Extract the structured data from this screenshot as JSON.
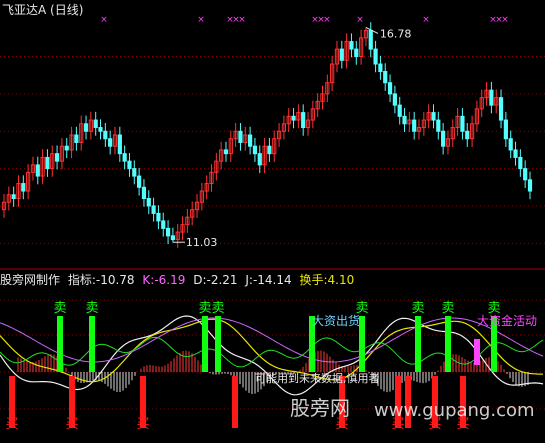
{
  "title": {
    "stock": "飞亚达A",
    "period": "(日线)"
  },
  "indicator": {
    "source": "股旁网制作",
    "zhibiao": "指标:-10.78",
    "k": "K:-6.19",
    "d": "D:-2.21",
    "j": "J:-14.14",
    "turnover": "换手:4.10"
  },
  "annotations": {
    "high_price": "16.78",
    "low_price": "11.03",
    "big_money_out": "大资出货",
    "big_money_active": "大资金活动",
    "future_warning": "可能用到未来数据,慎用者",
    "watermark_cn": "股旁网",
    "watermark_url": "www.gupang.com"
  },
  "signals": {
    "sell": "卖",
    "buy": "买",
    "mark": "×"
  },
  "colors": {
    "up": "#ff3232",
    "down": "#54ffff",
    "grid": "#8b0000",
    "sell_bar": "#11ff11",
    "buy_bar": "#ff1a1a",
    "magenta": "#ff44ff",
    "white_line": "#f0f0f0",
    "yellow_line": "#e6e600",
    "purple_line": "#cc66ff",
    "green_line": "#22dd22"
  },
  "chart_data": {
    "type": "candlestick",
    "price_range": [
      10.5,
      17.3
    ],
    "close_series": [
      12.1,
      12.3,
      12.2,
      12.6,
      12.4,
      12.9,
      13.1,
      12.8,
      13.3,
      13.0,
      13.4,
      13.2,
      13.6,
      13.5,
      13.9,
      13.7,
      14.2,
      14.0,
      14.3,
      14.1,
      14.0,
      13.8,
      13.6,
      13.9,
      13.4,
      13.2,
      13.0,
      12.8,
      12.5,
      12.2,
      12.0,
      11.8,
      11.6,
      11.4,
      11.2,
      11.1,
      11.3,
      11.5,
      11.7,
      11.9,
      12.1,
      12.4,
      12.6,
      12.9,
      13.2,
      13.5,
      13.4,
      13.8,
      14.0,
      13.7,
      13.9,
      13.6,
      13.4,
      13.1,
      13.6,
      13.4,
      13.8,
      14.0,
      14.2,
      14.4,
      14.3,
      14.5,
      14.1,
      14.3,
      14.6,
      14.8,
      15.0,
      15.3,
      15.8,
      16.2,
      15.9,
      16.4,
      16.2,
      16.0,
      16.5,
      16.7,
      16.2,
      15.8,
      15.6,
      15.3,
      15.0,
      14.7,
      14.4,
      14.2,
      14.3,
      14.0,
      14.1,
      14.3,
      14.5,
      14.3,
      14.0,
      13.6,
      13.8,
      14.1,
      14.4,
      14.0,
      13.8,
      14.2,
      14.6,
      14.9,
      15.1,
      14.7,
      14.9,
      14.3,
      13.8,
      13.5,
      13.3,
      13.0,
      12.7,
      12.4
    ],
    "high": 16.78,
    "low": 11.03,
    "x_marks_count": 13,
    "oscillator": {
      "indicator": -10.78,
      "k": -6.19,
      "d": -2.21,
      "j": -14.14,
      "turnover": 4.1,
      "sell_signals": 9,
      "buy_signals": 9,
      "big_money_active_bars": 1
    }
  }
}
